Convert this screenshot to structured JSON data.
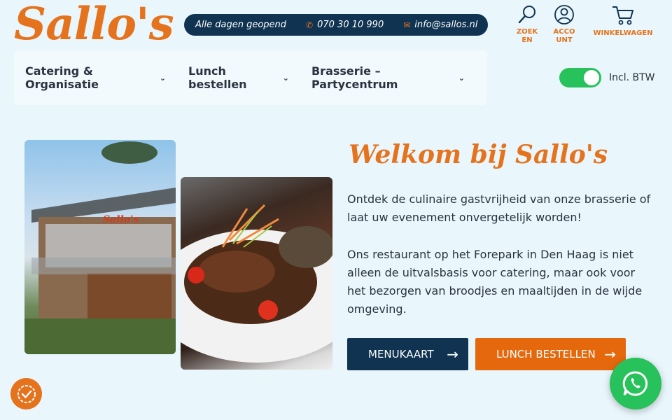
{
  "brand": {
    "logo_text": "Sallo's",
    "accent_color": "#e5731e",
    "navy_color": "#0f3350",
    "toggle_color": "#27c25b"
  },
  "info_bar": {
    "opening": "Alle dagen geopend",
    "phone": "070 30 10 990",
    "phone_icon": "phone-icon",
    "email": "info@sallos.nl",
    "email_icon": "envelope-icon"
  },
  "header_icons": {
    "search_label_1": "ZOEK",
    "search_label_2": "EN",
    "account_label_1": "ACCO",
    "account_label_2": "UNT",
    "cart_label": "WINKELWAGEN"
  },
  "nav": {
    "items": [
      {
        "label": "Catering & Organisatie"
      },
      {
        "label": "Lunch bestellen"
      },
      {
        "label": "Brasserie – Partycentrum"
      }
    ]
  },
  "btw_toggle": {
    "label": "Incl. BTW",
    "state": "on"
  },
  "hero": {
    "title": "Welkom bij Sallo's",
    "paragraph_1": "Ontdek de culinaire gastvrijheid van onze brasserie of laat uw evenement onvergetelijk worden!",
    "paragraph_2": "Ons restaurant op het Forepark in Den Haag is niet alleen de uitvalsbasis voor catering, maar ook voor het bezorgen van broodjes en maaltijden in de wijde omgeving.",
    "btn_menu": "MENUKAART",
    "btn_lunch": "LUNCH BESTELLEN",
    "arrow_icon": "arrow-right-icon"
  },
  "widgets": {
    "cookie_icon": "cookie-consent-icon",
    "whatsapp_icon": "whatsapp-icon"
  }
}
